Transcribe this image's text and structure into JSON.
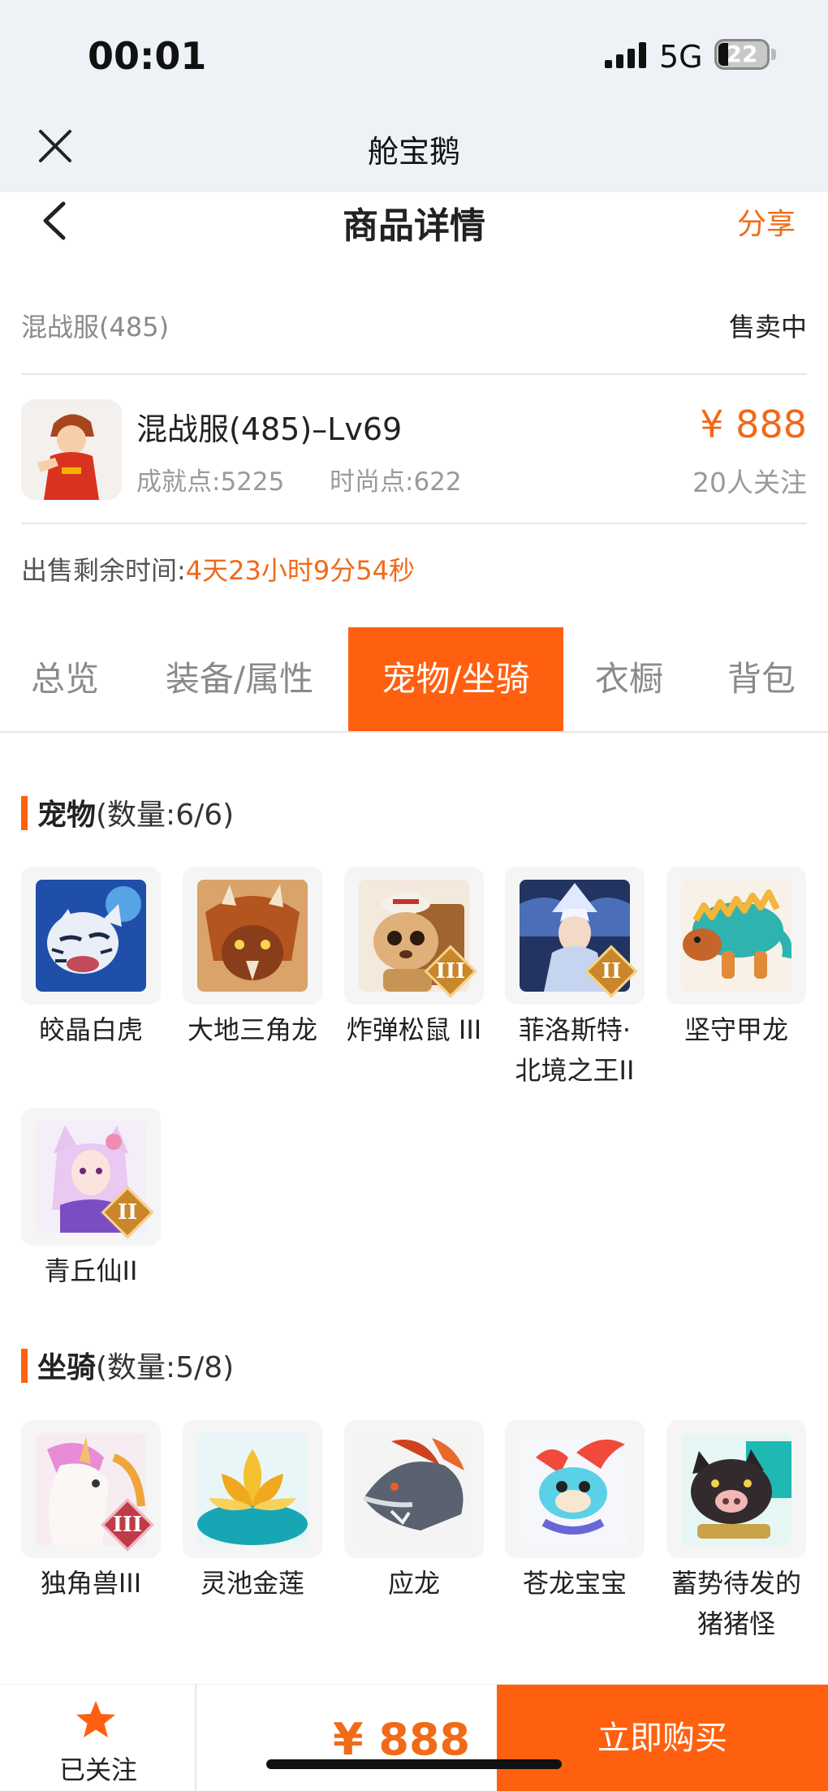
{
  "status_bar": {
    "time": "00:01",
    "network": "5G",
    "battery": "22"
  },
  "app_bar": {
    "title": "舱宝鹅"
  },
  "nav": {
    "title": "商品详情",
    "share": "分享"
  },
  "server": {
    "name": "混战服(485)",
    "status": "售卖中"
  },
  "product": {
    "name": "混战服(485)–Lv69",
    "achievement": "成就点:5225",
    "fashion": "时尚点:622",
    "price": "¥ 888",
    "followers": "20人关注"
  },
  "timer": {
    "label": "出售剩余时间:",
    "value": "4天23小时9分54秒"
  },
  "tabs": [
    "总览",
    "装备/属性",
    "宠物/坐骑",
    "衣橱",
    "背包"
  ],
  "active_tab": 2,
  "pets": {
    "title": "宠物",
    "count": "(数量:6/6)",
    "items": [
      {
        "name": "皎晶白虎",
        "icon": "white-tiger-icon"
      },
      {
        "name": "大地三角龙",
        "icon": "triceratops-icon"
      },
      {
        "name": "炸弹松鼠 III",
        "icon": "bomb-squirrel-icon",
        "badge": "III"
      },
      {
        "name": "菲洛斯特·北境之王II",
        "line1": "菲洛斯特·",
        "line2": "北境之王II",
        "icon": "frost-king-icon",
        "badge": "II"
      },
      {
        "name": "坚守甲龙",
        "icon": "ankylosaur-icon"
      },
      {
        "name": "青丘仙II",
        "icon": "fox-fairy-icon",
        "badge": "II"
      }
    ]
  },
  "mounts": {
    "title": "坐骑",
    "count": "(数量:5/8)",
    "items": [
      {
        "name": "独角兽III",
        "icon": "unicorn-icon",
        "badge": "III"
      },
      {
        "name": "灵池金莲",
        "icon": "golden-lotus-icon"
      },
      {
        "name": "应龙",
        "icon": "dragon-icon"
      },
      {
        "name": "苍龙宝宝",
        "icon": "baby-dragon-icon"
      },
      {
        "name": "蓄势待发的猪猪怪",
        "line1": "蓄势待发的",
        "line2": "猪猪怪",
        "icon": "pig-monster-icon"
      }
    ]
  },
  "bottom": {
    "follow_label": "已关注",
    "price": "¥ 888",
    "buy_label": "立即购买"
  },
  "colors": {
    "accent": "#ff6010",
    "price": "#f06a18"
  }
}
